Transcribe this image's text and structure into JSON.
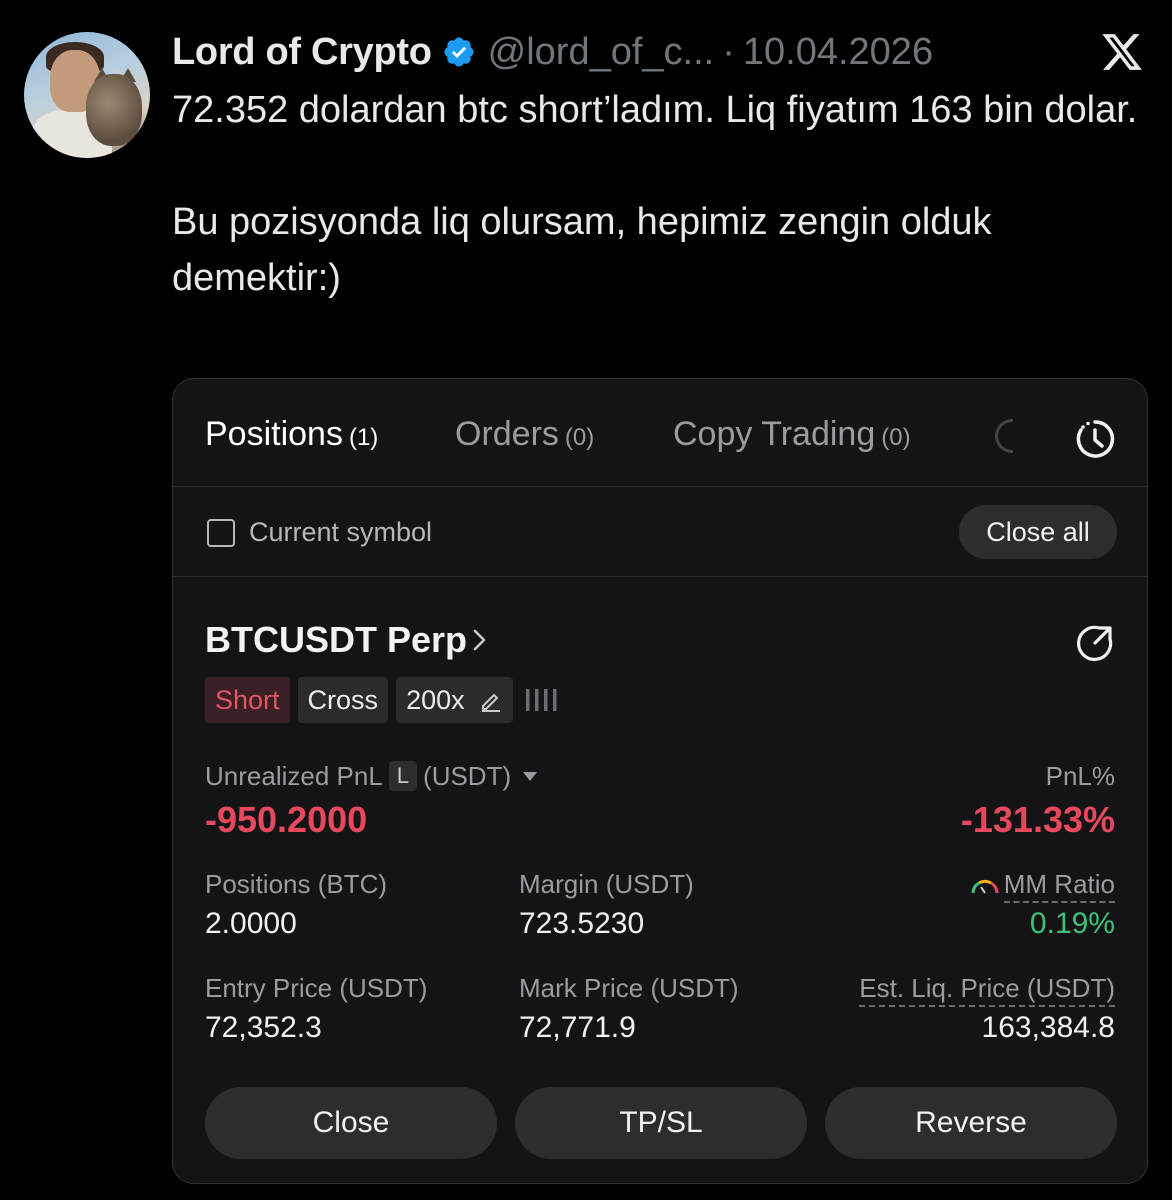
{
  "tweet": {
    "display_name": "Lord of Crypto",
    "handle": "@lord_of_c...",
    "separator": "·",
    "date": "10.04.2026",
    "text_line1": "72.352 dolardan btc short’ladım. Liq fiyatım 163 bin dolar.",
    "text_line2": "Bu pozisyonda liq olursam, hepimiz zengin olduk demektir:)",
    "colors": {
      "background": "#000000",
      "text": "#e7e9ea",
      "muted": "#71767b",
      "verified": "#1d9bf0"
    }
  },
  "card": {
    "tabs": [
      {
        "label": "Positions",
        "count": "(1)"
      },
      {
        "label": "Orders",
        "count": "(0)"
      },
      {
        "label": "Copy Trading",
        "count": "(0)"
      }
    ],
    "current_symbol_label": "Current symbol",
    "close_all_label": "Close all",
    "symbol": "BTCUSDT Perp",
    "tags": {
      "side": "Short",
      "margin_mode": "Cross",
      "leverage": "200x"
    },
    "unrealized_pnl": {
      "label": "Unrealized PnL",
      "badge": "L",
      "unit": "(USDT)",
      "value": "-950.2000"
    },
    "pnl_percent": {
      "label": "PnL%",
      "value": "-131.33%"
    },
    "positions": {
      "label": "Positions (BTC)",
      "value": "2.0000"
    },
    "margin": {
      "label": "Margin (USDT)",
      "value": "723.5230"
    },
    "mm_ratio": {
      "label": "MM Ratio",
      "value": "0.19%"
    },
    "entry_price": {
      "label": "Entry Price (USDT)",
      "value": "72,352.3"
    },
    "mark_price": {
      "label": "Mark Price (USDT)",
      "value": "72,771.9"
    },
    "liq_price": {
      "label": "Est. Liq. Price (USDT)",
      "value": "163,384.8"
    },
    "buttons": {
      "close": "Close",
      "tpsl": "TP/SL",
      "reverse": "Reverse"
    },
    "colors": {
      "negative": "#e8485c",
      "positive": "#3cc27a",
      "panel": "#141416"
    }
  }
}
